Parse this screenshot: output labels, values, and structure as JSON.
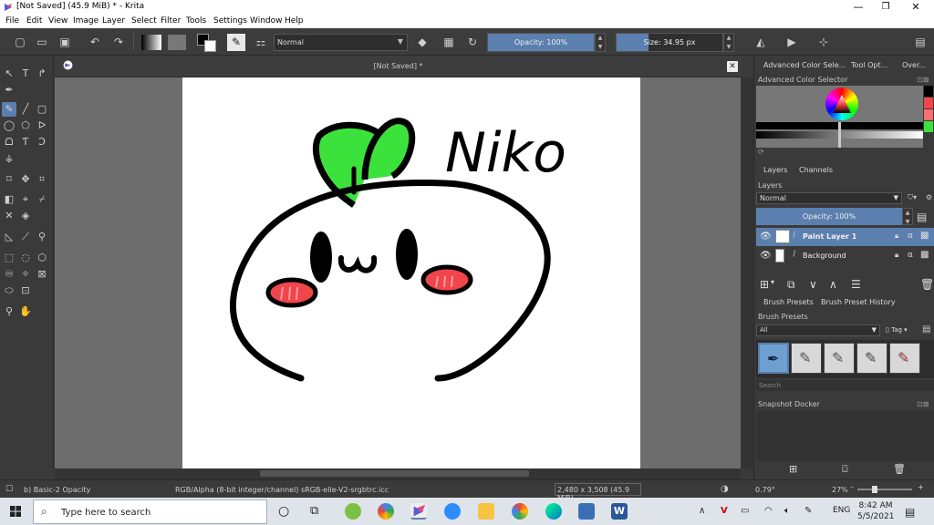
{
  "window": {
    "title": "[Not Saved]  (45.9 MiB)  * - Krita",
    "minimize": "—",
    "maximize": "❐",
    "close": "✕"
  },
  "menu": [
    "File",
    "Edit",
    "View",
    "Image",
    "Layer",
    "Select",
    "Filter",
    "Tools",
    "Settings",
    "Window",
    "Help"
  ],
  "toolbar": {
    "blend_mode": "Normal",
    "opacity_label": "Opacity: 100%",
    "opacity_value": 100,
    "size_label": "Size: 34.95 px"
  },
  "canvas": {
    "tab_title": "[Not Saved]  *",
    "drawing_text": "Niko"
  },
  "dock": {
    "top_tabs": [
      "Advanced Color Sele...",
      "Tool Opt...",
      "Over..."
    ],
    "color_selector_title": "Advanced Color Selector",
    "layer_tabs": [
      "Layers",
      "Channels"
    ],
    "layers_title": "Layers",
    "layer_blend": "Normal",
    "layer_opacity": "Opacity:  100%",
    "layers": [
      {
        "name": "Paint Layer 1",
        "selected": true
      },
      {
        "name": "Background",
        "selected": false
      }
    ],
    "brush_tabs": [
      "Brush Presets",
      "Brush Preset History"
    ],
    "brush_title": "Brush Presets",
    "brush_filter": "All",
    "brush_tag": "Tag",
    "brush_search": "Search",
    "snapshot_title": "Snapshot Docker"
  },
  "status": {
    "brush": "b) Basic-2 Opacity",
    "colorspace": "RGB/Alpha (8-bit integer/channel)  sRGB-elle-V2-srgbtrc.icc",
    "dimensions": "2,480 x 3,508 (45.9 MiB)",
    "rotation": "0.79°",
    "zoom": "27%"
  },
  "taskbar": {
    "search_placeholder": "Type here to search",
    "language": "ENG",
    "time": "8:42 AM",
    "date": "5/5/2021"
  },
  "colors": {
    "accent": "#5b7fae",
    "sprout_green": "#3ce23c",
    "cheek_red": "#f0454b"
  }
}
